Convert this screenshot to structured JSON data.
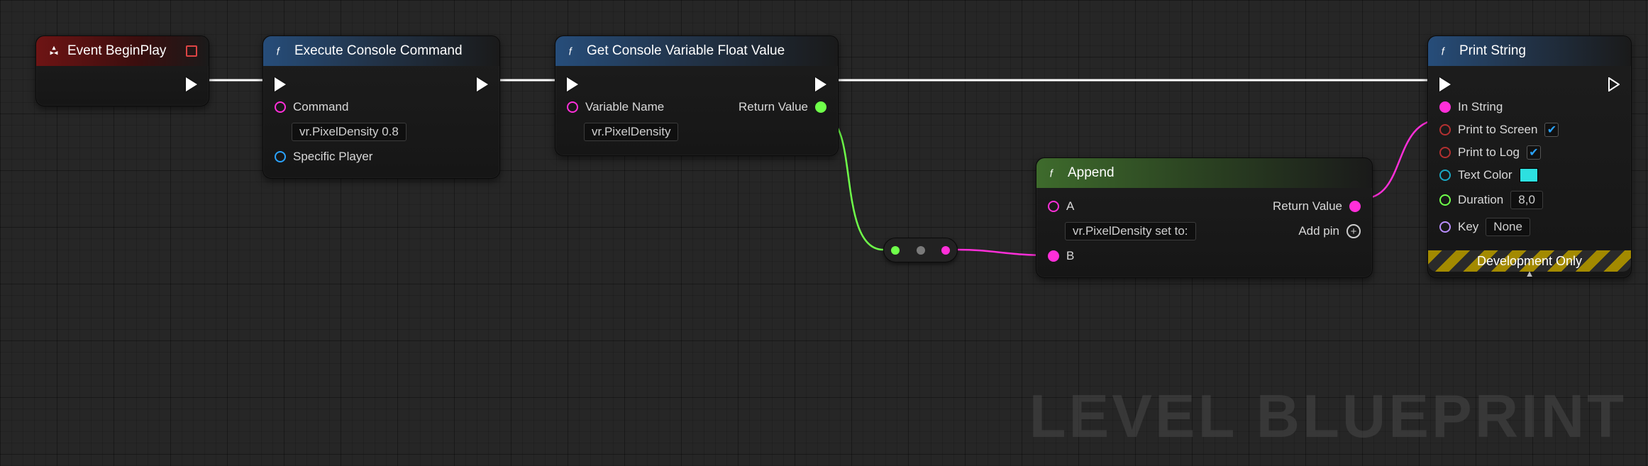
{
  "watermark": "LEVEL BLUEPRINT",
  "nodes": {
    "beginPlay": {
      "title": "Event BeginPlay"
    },
    "execCmd": {
      "title": "Execute Console Command",
      "commandLabel": "Command",
      "commandValue": "vr.PixelDensity 0.8",
      "specificPlayerLabel": "Specific Player"
    },
    "getCvar": {
      "title": "Get Console Variable Float Value",
      "varNameLabel": "Variable Name",
      "varNameValue": "vr.PixelDensity",
      "returnLabel": "Return Value"
    },
    "append": {
      "title": "Append",
      "aLabel": "A",
      "aValue": "vr.PixelDensity set to:",
      "bLabel": "B",
      "returnLabel": "Return Value",
      "addPinLabel": "Add pin"
    },
    "printStr": {
      "title": "Print String",
      "inStringLabel": "In String",
      "printScreenLabel": "Print to Screen",
      "printLogLabel": "Print to Log",
      "textColorLabel": "Text Color",
      "durationLabel": "Duration",
      "durationValue": "8,0",
      "keyLabel": "Key",
      "keyValue": "None",
      "devOnly": "Development Only",
      "printScreenChecked": true,
      "printLogChecked": true,
      "textColorValue": "#2de0e0"
    }
  }
}
